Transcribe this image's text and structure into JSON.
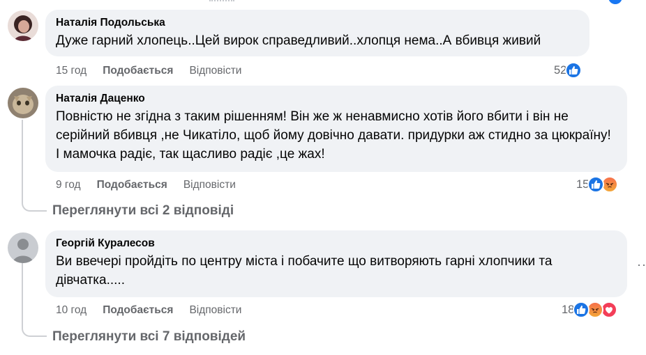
{
  "comments": [
    {
      "author": "Наталія Подольська",
      "text": "Дуже гарний хлопець..Цей вирок справедливий..хлопця нема..А вбивця живий",
      "time": "15 год",
      "like_label": "Подобається",
      "reply_label": "Відповісти",
      "reaction_count": "52",
      "reactions": [
        "like"
      ]
    },
    {
      "author": "Наталія Даценко",
      "text": "Повністю не згідна з таким рішенням! Він же ж ненавмисно хотів його вбити і він не серійний вбивця ,не Чикатіло, щоб йому довічно давати. придурки аж стидно за цюкраїну! І мамочка радіє, так щасливо радіє ,це жах!",
      "time": "9 год",
      "like_label": "Подобається",
      "reply_label": "Відповісти",
      "reaction_count": "15",
      "reactions": [
        "like",
        "angry"
      ],
      "view_replies": "Переглянути всі 2 відповіді"
    },
    {
      "author": "Георгій Куралесов",
      "text": "Ви ввечері пройдіть по центру міста і побачите що витворяють гарні хлопчики та дівчатка.....",
      "time": "10 год",
      "like_label": "Подобається",
      "reply_label": "Відповісти",
      "reaction_count": "18",
      "reactions": [
        "like",
        "angry",
        "love"
      ],
      "view_replies": "Переглянути всі 7 відповідей"
    }
  ],
  "more_options": "···",
  "colors": {
    "bubble": "#f0f2f5",
    "secondary_text": "#65676b",
    "like_blue": "#1b74e4",
    "love_red": "#f33e58",
    "angry_orange": "#f7714b"
  }
}
